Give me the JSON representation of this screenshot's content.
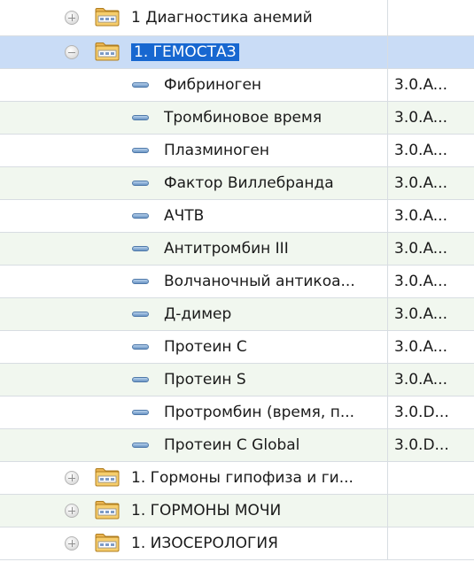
{
  "tree": {
    "rows": [
      {
        "type": "group",
        "state": "collapsed",
        "label": "1 Диагностика анемий",
        "code": ""
      },
      {
        "type": "group",
        "state": "expanded",
        "selected": true,
        "label": "1. ГЕМОСТАЗ",
        "code": ""
      },
      {
        "type": "item",
        "label": "Фибриноген",
        "code": "3.0.A..."
      },
      {
        "type": "item",
        "label": "Тромбиновое время",
        "code": "3.0.A..."
      },
      {
        "type": "item",
        "label": "Плазминоген",
        "code": "3.0.A..."
      },
      {
        "type": "item",
        "label": "Фактор Виллебранда",
        "code": "3.0.A..."
      },
      {
        "type": "item",
        "label": "АЧТВ",
        "code": "3.0.A..."
      },
      {
        "type": "item",
        "label": "Антитромбин III",
        "code": "3.0.A..."
      },
      {
        "type": "item",
        "label": "Волчаночный антикоа...",
        "code": "3.0.A..."
      },
      {
        "type": "item",
        "label": "Д-димер",
        "code": "3.0.A..."
      },
      {
        "type": "item",
        "label": "Протеин С",
        "code": "3.0.A..."
      },
      {
        "type": "item",
        "label": "Протеин S",
        "code": "3.0.A..."
      },
      {
        "type": "item",
        "label": "Протромбин (время, п...",
        "code": "3.0.D..."
      },
      {
        "type": "item",
        "label": "Протеин С Global",
        "code": "3.0.D..."
      },
      {
        "type": "group",
        "state": "collapsed",
        "label": "1. Гормоны гипофиза и ги...",
        "code": ""
      },
      {
        "type": "group",
        "state": "collapsed",
        "label": "1. ГОРМОНЫ МОЧИ",
        "code": ""
      },
      {
        "type": "group",
        "state": "collapsed",
        "label": "1. ИЗОСЕРОЛОГИЯ",
        "code": ""
      }
    ]
  },
  "icons": {
    "expand": "plus-expander-icon",
    "collapse": "minus-expander-icon",
    "folder": "folder-icon",
    "item": "test-item-icon"
  },
  "colors": {
    "selected_row": "#c9dcf6",
    "selected_label": "#1767d0",
    "alt_row": "#f1f7ef",
    "grid": "#d8dde2"
  }
}
